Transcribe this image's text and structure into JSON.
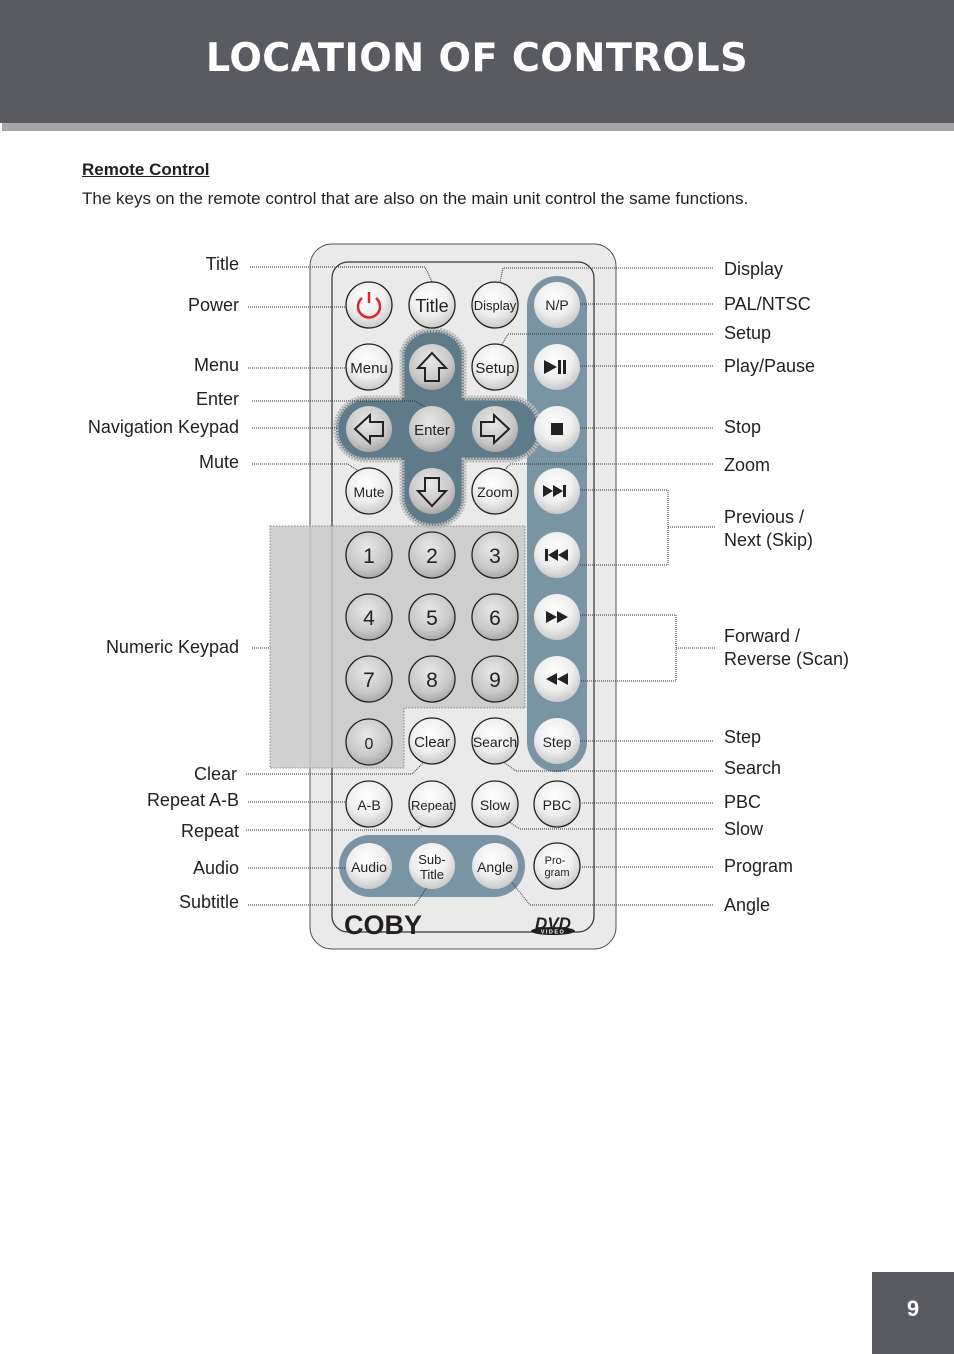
{
  "header": {
    "title": "LOCATION OF CONTROLS"
  },
  "section": {
    "title": "Remote Control",
    "intro": "The keys on the remote control that are also on the main unit control the same functions."
  },
  "callouts": {
    "left": [
      "Title",
      "Power",
      "Menu",
      "Enter",
      "Navigation Keypad",
      "Mute",
      "Numeric Keypad",
      "Clear",
      "Repeat A-B",
      "Repeat",
      "Audio",
      "Subtitle"
    ],
    "right": [
      "Display",
      "PAL/NTSC",
      "Setup",
      "Play/Pause",
      "Stop",
      "Zoom",
      "Previous /",
      "Next (Skip)",
      "Forward /",
      "Reverse (Scan)",
      "Step",
      "Search",
      "PBC",
      "Slow",
      "Program",
      "Angle"
    ]
  },
  "remote": {
    "buttons": {
      "power": "power-icon",
      "title": "Title",
      "display": "Display",
      "np": "N/P",
      "menu": "Menu",
      "setup": "Setup",
      "play_pause": "play-pause-icon",
      "enter": "Enter",
      "stop": "stop-icon",
      "mute": "Mute",
      "zoom": "Zoom",
      "next": "next-icon",
      "prev": "previous-icon",
      "forward": "fast-forward-icon",
      "reverse": "rewind-icon",
      "step": "Step",
      "clear": "Clear",
      "search": "Search",
      "ab": "A-B",
      "repeat": "Repeat",
      "slow": "Slow",
      "pbc": "PBC",
      "audio": "Audio",
      "subtitle_1": "Sub-",
      "subtitle_2": "Title",
      "angle": "Angle",
      "program_1": "Pro-",
      "program_2": "gram"
    },
    "digits": [
      "1",
      "2",
      "3",
      "4",
      "5",
      "6",
      "7",
      "8",
      "9",
      "0"
    ],
    "brand": "COBY",
    "logo_top": "DVD",
    "logo_bottom": "VIDEO"
  },
  "colors": {
    "header_bg": "#595b60",
    "strip": "#a7a6a8",
    "column_blue": "#7995a4",
    "navpad_blue": "#5f7a88",
    "power_red": "#e0262b",
    "remote_body": "#eaeaea",
    "numeric_pad": "#c7c7c7"
  },
  "page": {
    "number": "9"
  }
}
